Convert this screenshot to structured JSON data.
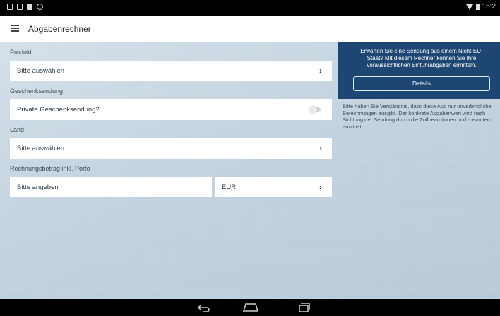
{
  "statusbar": {
    "time": "15:2"
  },
  "appbar": {
    "title": "Abgabenrechner"
  },
  "form": {
    "product": {
      "label": "Produkt",
      "value": "Bitte auswählen"
    },
    "gift": {
      "label": "Geschenksendung",
      "value": "Private Geschenksendung?",
      "checked": false
    },
    "country": {
      "label": "Land",
      "value": "Bitte auswählen"
    },
    "invoice": {
      "label": "Rechnungsbetrag inkl. Porto",
      "amount_placeholder": "Bitte angeben",
      "currency": "EUR"
    }
  },
  "info": {
    "text": "Erwarten Sie eine Sendung aus einem Nicht-EU-Staat? Mit diesem Rechner können Sie Ihre voraussichtlichen Einfuhrabgaben ermitteln.",
    "button": "Details",
    "disclaimer": "Bitte haben Sie Verständnis, dass diese App nur unverbindliche Berechnungen ausgibt. Der konkrete Abgabenwert wird nach Sichtung der Sendung durch die Zollbeamtinnen und -beamten ermittelt."
  },
  "icons": {
    "menu": "hamburger-icon",
    "chevron": "chevron-right-icon",
    "back": "back-icon",
    "home": "home-icon",
    "recent": "recent-apps-icon"
  },
  "colors": {
    "accent": "#1d4672",
    "chevron": "#1d3b5e"
  }
}
